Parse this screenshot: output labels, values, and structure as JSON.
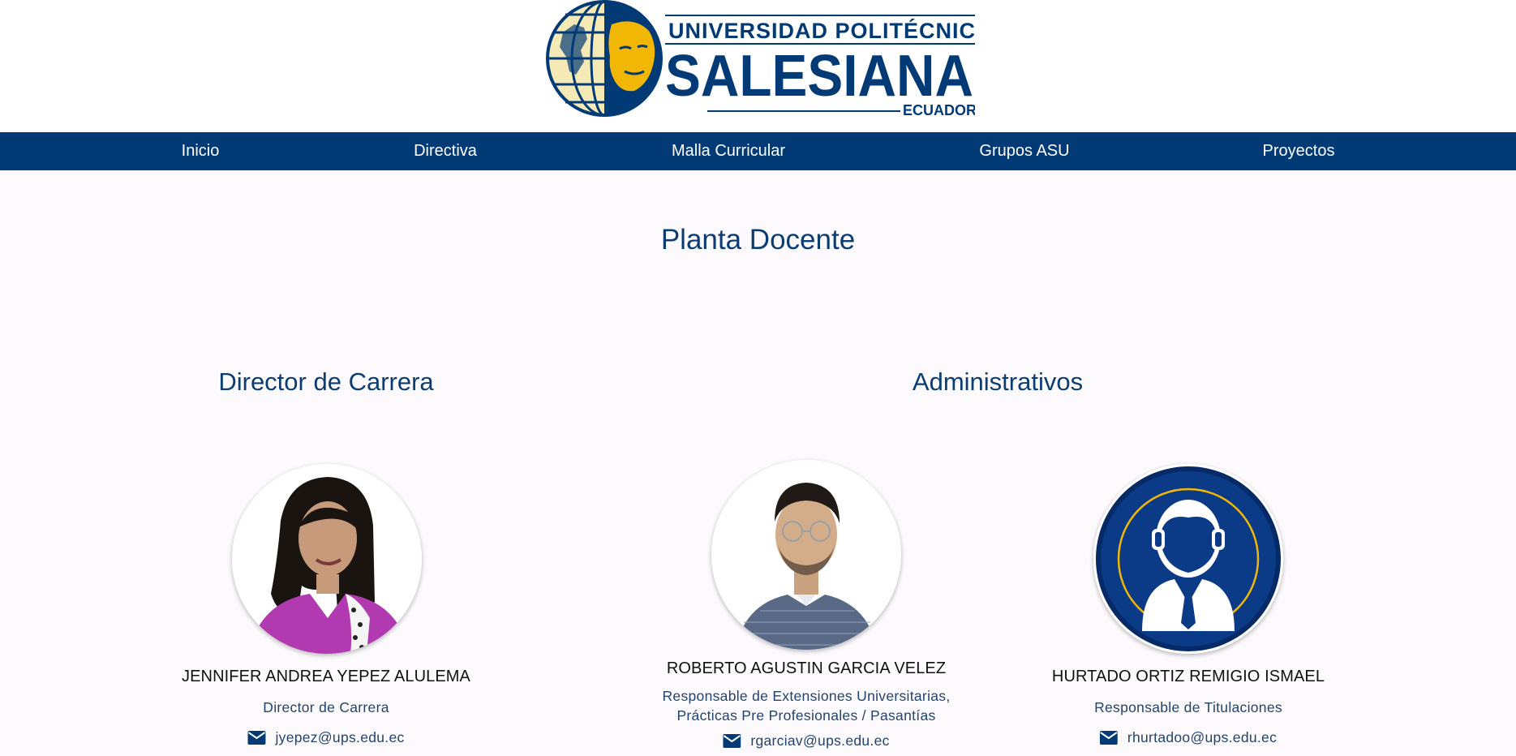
{
  "header": {
    "logo": {
      "line1": "UNIVERSIDAD POLITÉCNICA",
      "line2": "SALESIANA",
      "line3": "ECUADOR"
    }
  },
  "nav": {
    "items": [
      "Inicio",
      "Directiva",
      "Malla Curricular",
      "Grupos ASU",
      "Proyectos"
    ]
  },
  "main": {
    "title": "Planta Docente",
    "sections": {
      "director": "Director de Carrera",
      "admin": "Administrativos"
    },
    "people": [
      {
        "name": "JENNIFER ANDREA YEPEZ ALULEMA",
        "role_lines": [
          "Director de Carrera"
        ],
        "email": "jyepez@ups.edu.ec",
        "icon": "mail-icon"
      },
      {
        "name": "ROBERTO AGUSTIN GARCIA VELEZ",
        "role_lines": [
          "Responsable de Extensiones Universitarias,",
          "Prácticas Pre Profesionales / Pasantías"
        ],
        "email": "rgarciav@ups.edu.ec",
        "icon": "mail-icon"
      },
      {
        "name": "HURTADO ORTIZ REMIGIO ISMAEL",
        "role_lines": [
          "Responsable de Titulaciones"
        ],
        "email": "rhurtadoo@ups.edu.ec",
        "icon": "mail-icon"
      }
    ]
  },
  "colors": {
    "brand_blue": "#023a76",
    "brand_gold": "#f2b705",
    "title_blue": "#0b3d73",
    "text_blue": "#23446e",
    "background": "#fcfafd"
  }
}
